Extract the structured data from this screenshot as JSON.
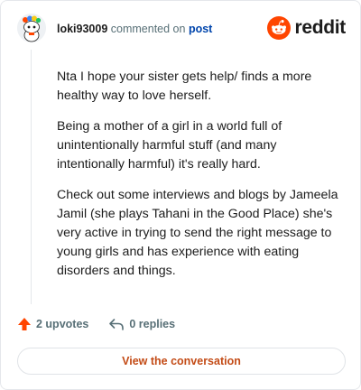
{
  "comment": {
    "username": "loki93009",
    "action_text": "commented on",
    "post_link": "post",
    "paragraphs": [
      "Nta I hope your sister gets help/ finds a more healthy way to love herself.",
      "Being a mother of a girl in a world full of unintentionally harmful stuff (and many intentionally harmful) it's really hard.",
      "Check out some interviews and blogs by Jameela Jamil (she plays Tahani in the Good Place) she's very active in trying to send the right message to young girls and has experience with eating disorders and things."
    ],
    "upvotes": "2 upvotes",
    "replies": "0 replies"
  },
  "brand": {
    "name": "reddit",
    "color": "#ff4500"
  },
  "cta": {
    "label": "View the conversation"
  },
  "icons": {
    "avatar": "snoo-avatar-icon",
    "logo": "reddit-logo-icon",
    "upvote": "upvote-arrow-icon",
    "reply": "reply-arrow-icon"
  }
}
